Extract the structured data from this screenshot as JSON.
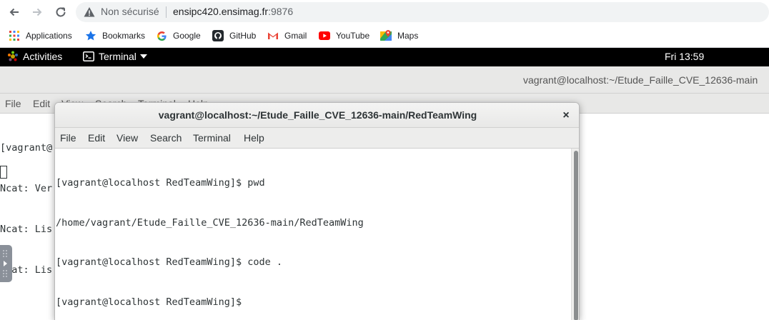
{
  "browser": {
    "security_label": "Non sécurisé",
    "url_host": "ensipc420.ensimag.fr",
    "url_port": ":9876",
    "bookmarks": [
      {
        "label": "Applications",
        "icon": "apps-grid-icon"
      },
      {
        "label": "Bookmarks",
        "icon": "star-icon"
      },
      {
        "label": "Google",
        "icon": "google-icon"
      },
      {
        "label": "GitHub",
        "icon": "github-icon"
      },
      {
        "label": "Gmail",
        "icon": "gmail-icon"
      },
      {
        "label": "YouTube",
        "icon": "youtube-icon"
      },
      {
        "label": "Maps",
        "icon": "maps-icon"
      }
    ]
  },
  "gnome": {
    "activities": "Activities",
    "app_menu": "Terminal",
    "clock": "Fri 13:59"
  },
  "bg_terminal": {
    "title": "vagrant@localhost:~/Etude_Faille_CVE_12636-main",
    "menu": [
      "File",
      "Edit",
      "View",
      "Search",
      "Terminal",
      "Help"
    ],
    "lines": [
      "[vagrant@",
      "Ncat: Ver",
      "Ncat: Lis",
      "Ncat: Lis"
    ]
  },
  "fg_terminal": {
    "title": "vagrant@localhost:~/Etude_Faille_CVE_12636-main/RedTeamWing",
    "close": "×",
    "menu": [
      "File",
      "Edit",
      "View",
      "Search",
      "Terminal",
      "Help"
    ],
    "lines": [
      "[vagrant@localhost RedTeamWing]$ pwd",
      "/home/vagrant/Etude_Faille_CVE_12636-main/RedTeamWing",
      "[vagrant@localhost RedTeamWing]$ code .",
      "[vagrant@localhost RedTeamWing]$ "
    ]
  },
  "colors": {
    "gnome_bar": "#000000",
    "terminal_text": "#2e3436",
    "youtube_red": "#ff0000",
    "bookmark_star": "#1a73e8"
  }
}
